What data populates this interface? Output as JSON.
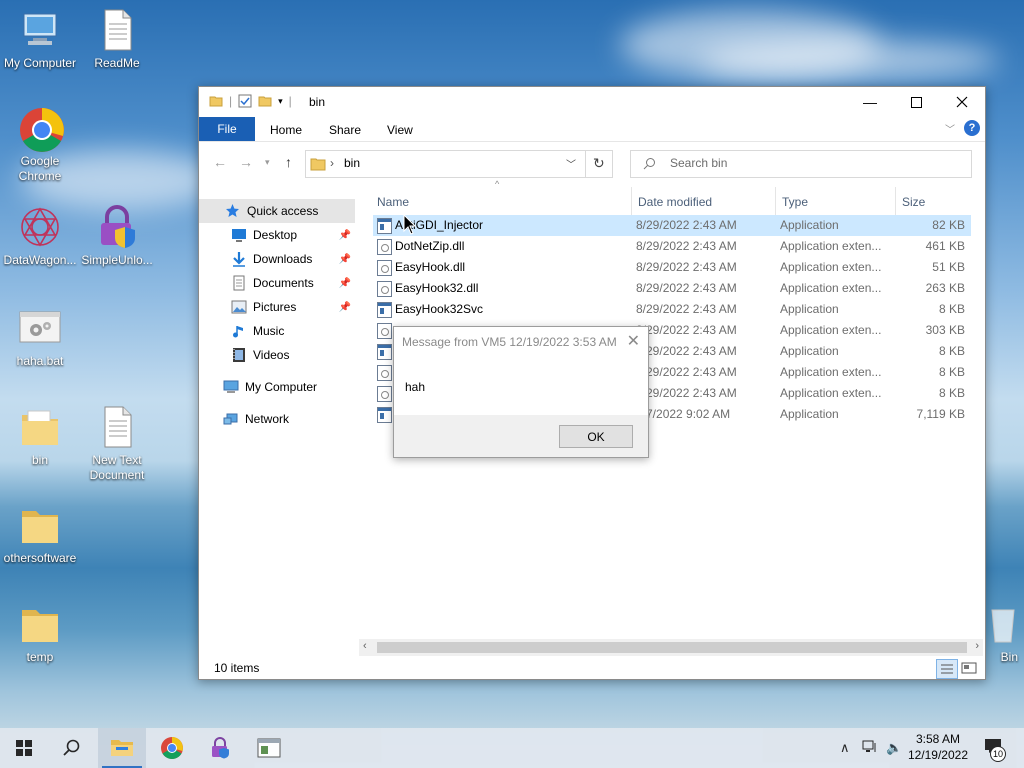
{
  "desktop": {
    "icons": [
      {
        "label": "My Computer",
        "icon": "computer-icon"
      },
      {
        "label": "ReadMe",
        "icon": "text-document-icon"
      },
      {
        "label": "Google Chrome",
        "icon": "chrome-icon"
      },
      {
        "label": "DataWagon...",
        "icon": "datawagon-icon"
      },
      {
        "label": "SimpleUnlo...",
        "icon": "padlock-shield-icon"
      },
      {
        "label": "haha.bat",
        "icon": "batch-file-icon"
      },
      {
        "label": "bin",
        "icon": "folder-icon"
      },
      {
        "label": "New Text Document",
        "icon": "text-document-icon"
      },
      {
        "label": "othersoftware",
        "icon": "folder-icon"
      },
      {
        "label": "temp",
        "icon": "folder-icon"
      },
      {
        "label": "Bin",
        "icon": "recycle-bin-icon"
      }
    ]
  },
  "explorer": {
    "title": "bin",
    "ribbon": {
      "file": "File",
      "tabs": [
        "Home",
        "Share",
        "View"
      ],
      "help": "?"
    },
    "address": {
      "path": "bin"
    },
    "search": {
      "placeholder": "Search bin"
    },
    "nav": [
      {
        "label": "Quick access",
        "icon": "star-icon",
        "pinned": false
      },
      {
        "label": "Desktop",
        "icon": "desktop-icon",
        "pinned": true
      },
      {
        "label": "Downloads",
        "icon": "download-icon",
        "pinned": true
      },
      {
        "label": "Documents",
        "icon": "documents-icon",
        "pinned": true
      },
      {
        "label": "Pictures",
        "icon": "pictures-icon",
        "pinned": true
      },
      {
        "label": "Music",
        "icon": "music-icon",
        "pinned": false
      },
      {
        "label": "Videos",
        "icon": "videos-icon",
        "pinned": false
      },
      {
        "label": "My Computer",
        "icon": "computer-icon",
        "pinned": false
      },
      {
        "label": "Network",
        "icon": "network-icon",
        "pinned": false
      }
    ],
    "columns": {
      "name": "Name",
      "date": "Date modified",
      "type": "Type",
      "size": "Size"
    },
    "files": [
      {
        "name": "AntiGDI_Injector",
        "date": "8/29/2022 2:43 AM",
        "type": "Application",
        "size": "82 KB",
        "icon": "application-icon",
        "selected": true
      },
      {
        "name": "DotNetZip.dll",
        "date": "8/29/2022 2:43 AM",
        "type": "Application exten...",
        "size": "461 KB",
        "icon": "dll-icon"
      },
      {
        "name": "EasyHook.dll",
        "date": "8/29/2022 2:43 AM",
        "type": "Application exten...",
        "size": "51 KB",
        "icon": "dll-icon"
      },
      {
        "name": "EasyHook32.dll",
        "date": "8/29/2022 2:43 AM",
        "type": "Application exten...",
        "size": "263 KB",
        "icon": "dll-icon"
      },
      {
        "name": "EasyHook32Svc",
        "date": "8/29/2022 2:43 AM",
        "type": "Application",
        "size": "8 KB",
        "icon": "application-icon"
      },
      {
        "name": "",
        "date": "8/29/2022 2:43 AM",
        "type": "Application exten...",
        "size": "303 KB",
        "icon": "dll-icon"
      },
      {
        "name": "",
        "date": "8/29/2022 2:43 AM",
        "type": "Application",
        "size": "8 KB",
        "icon": "application-icon"
      },
      {
        "name": "",
        "date": "8/29/2022 2:43 AM",
        "type": "Application exten...",
        "size": "8 KB",
        "icon": "dll-icon"
      },
      {
        "name": "",
        "date": "8/29/2022 2:43 AM",
        "type": "Application exten...",
        "size": "8 KB",
        "icon": "dll-icon"
      },
      {
        "name": "",
        "date": "7/7/2022 9:02 AM",
        "type": "Application",
        "size": "7,119 KB",
        "icon": "application-icon"
      }
    ],
    "status": {
      "count": "10 items"
    }
  },
  "dialog": {
    "title": "Message from VM5 12/19/2022 3:53 AM",
    "message": "hah",
    "ok": "OK"
  },
  "taskbar": {
    "apps": [
      "start-icon",
      "search-icon",
      "file-explorer-icon",
      "chrome-icon",
      "simpleunlocker-icon",
      "window-app-icon"
    ],
    "clock": {
      "time": "3:58 AM",
      "date": "12/19/2022"
    },
    "notifications": "10"
  }
}
